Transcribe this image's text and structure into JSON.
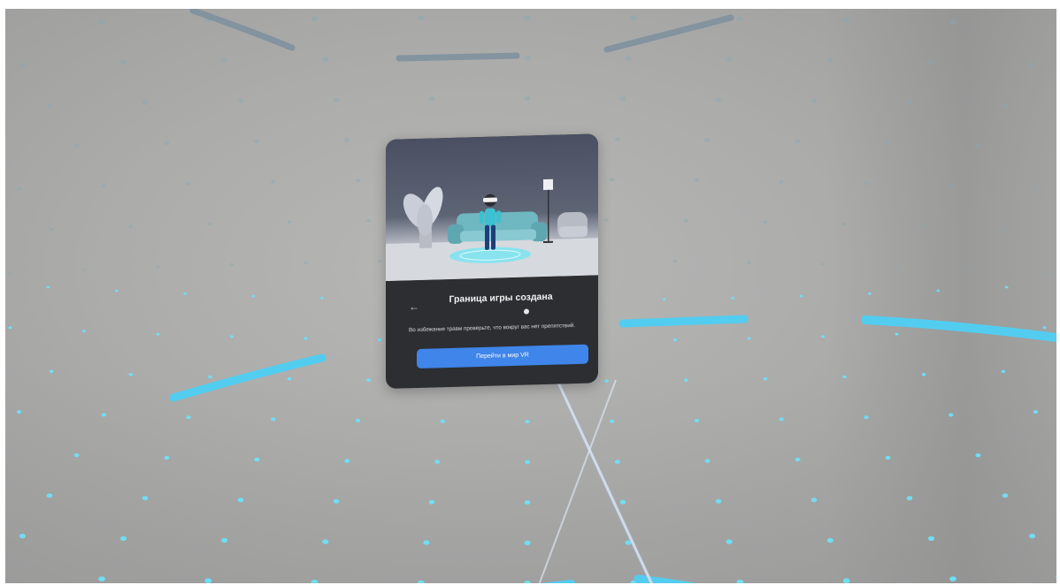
{
  "dialog": {
    "back_icon": "arrow-left-icon",
    "title": "Граница игры создана",
    "description": "Во избежание травм проверьте, что вокруг вас нет препятствий.",
    "primary_button_label": "Перейти в мир VR",
    "page_indicator": {
      "count": 1,
      "active": 1
    }
  },
  "colors": {
    "boundary": "#4ec9ee",
    "dots": "#6fdff7",
    "room_wall": "#acacab",
    "panel_bg": "#2d2e31",
    "button": "#3f85ea",
    "avatar_shirt": "#3bc1cf"
  }
}
